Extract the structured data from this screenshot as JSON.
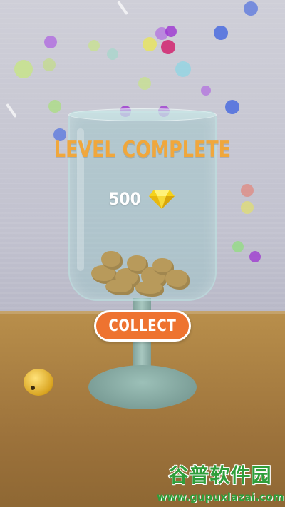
{
  "level_complete": {
    "title": "LEVEL COMPLETE",
    "reward": {
      "amount": "500",
      "icon": "gem-icon",
      "icon_color": "#f5d21c"
    },
    "collect_label": "COLLECT",
    "accent_color": "#ee7330",
    "title_color": "#f0a73c"
  },
  "watermark": {
    "logo_text": "谷普软件园",
    "url": "www.gupuxlazai.com"
  }
}
